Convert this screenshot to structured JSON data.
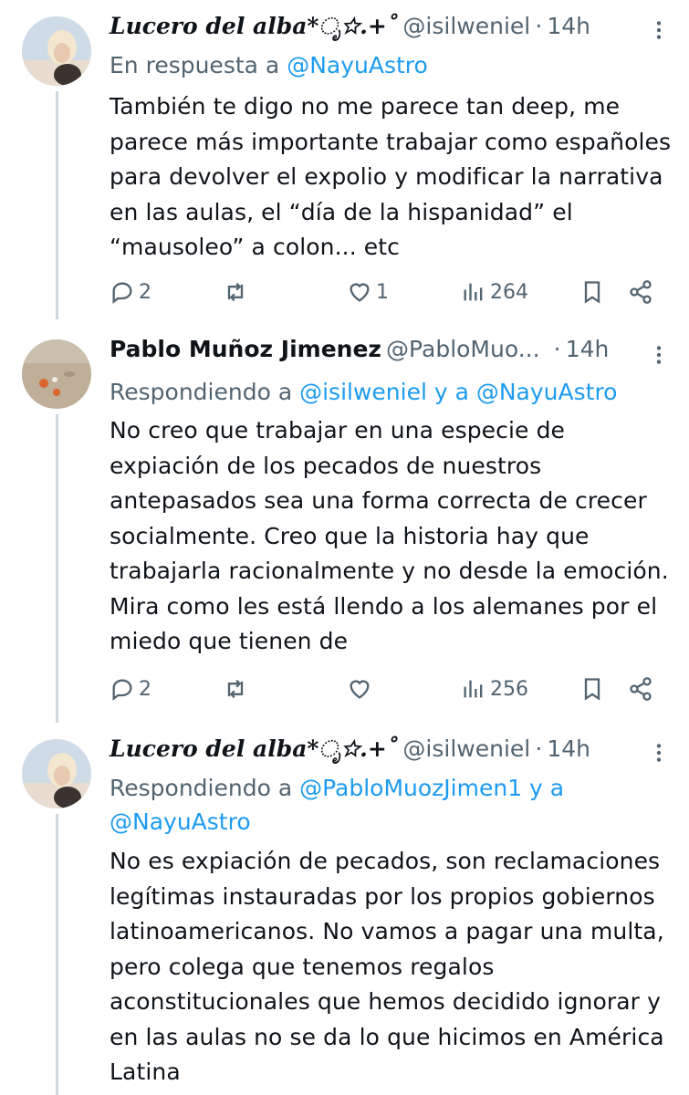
{
  "tweets": [
    {
      "name": "Lucero del alba*ೃ☆.+˚",
      "handle": "@isilweniel",
      "separator": "·",
      "time": "14h",
      "reply_prefix": "En respuesta a",
      "reply_to_line1": "@NayuAstro",
      "reply_line2": "",
      "body": "También te digo no me parece tan deep, me parece más importante trabajar como españoles para devolver el expolio y modificar la narrativa en las aulas, el “día de la hispanidad” el “mausoleo” a colon... etc",
      "stats": {
        "replies": "2",
        "retweets": "",
        "likes": "1",
        "views": "264"
      }
    },
    {
      "name": "Pablo Muñoz Jimenez",
      "handle": "@PabloMuo...",
      "separator": "·",
      "time": "14h",
      "reply_prefix": "Respondiendo a",
      "reply_to_line1": "@isilweniel y a @NayuAstro",
      "reply_line2": "",
      "body": "No creo que trabajar en una especie de expiación de los pecados de nuestros antepasados sea una forma correcta de crecer socialmente. Creo que la historia hay que trabajarla racionalmente y no desde la emoción. Mira como les está llendo a los alemanes por el miedo que tienen de",
      "stats": {
        "replies": "2",
        "retweets": "",
        "likes": "",
        "views": "256"
      }
    },
    {
      "name": "Lucero del alba*ೃ☆.+˚",
      "handle": "@isilweniel",
      "separator": "·",
      "time": "14h",
      "reply_prefix": "Respondiendo a",
      "reply_to_line1": "@PabloMuozJimen1 y a",
      "reply_line2": "@NayuAstro",
      "body": "No es expiación de pecados, son reclamaciones legítimas instauradas por los propios gobiernos latinoamericanos. No vamos a pagar una multa, pero colega que tenemos regalos aconstitucionales que hemos decidido ignorar y en las aulas no se da lo que hicimos en América Latina",
      "stats": {
        "replies": "",
        "retweets": "",
        "likes": "",
        "views": ""
      }
    }
  ],
  "colors": {
    "accent": "#1d9bf0",
    "muted": "#536471",
    "text": "#0f1419",
    "thread": "#cfd9de"
  }
}
